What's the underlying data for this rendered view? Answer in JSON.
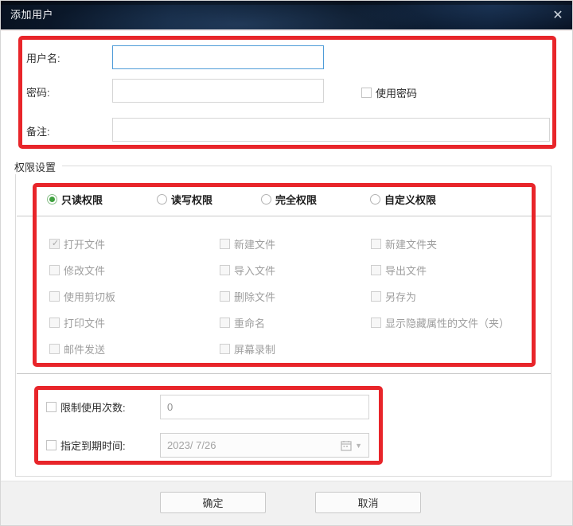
{
  "window": {
    "title": "添加用户",
    "close_glyph": "✕"
  },
  "form": {
    "username": {
      "label": "用户名:",
      "value": ""
    },
    "password": {
      "label": "密码:",
      "value": ""
    },
    "use_password": {
      "label": "使用密码",
      "checked": false
    },
    "note": {
      "label": "备注:",
      "value": ""
    }
  },
  "permissions": {
    "group_label": "权限设置",
    "levels": [
      {
        "label": "只读权限",
        "selected": true
      },
      {
        "label": "读写权限",
        "selected": false
      },
      {
        "label": "完全权限",
        "selected": false
      },
      {
        "label": "自定义权限",
        "selected": false
      }
    ],
    "items": [
      {
        "label": "打开文件",
        "checked": true,
        "disabled": true
      },
      {
        "label": "新建文件",
        "checked": false,
        "disabled": true
      },
      {
        "label": "新建文件夹",
        "checked": false,
        "disabled": true
      },
      {
        "label": "修改文件",
        "checked": false,
        "disabled": true
      },
      {
        "label": "导入文件",
        "checked": false,
        "disabled": true
      },
      {
        "label": "导出文件",
        "checked": false,
        "disabled": true
      },
      {
        "label": "使用剪切板",
        "checked": false,
        "disabled": true
      },
      {
        "label": "删除文件",
        "checked": false,
        "disabled": true
      },
      {
        "label": "另存为",
        "checked": false,
        "disabled": true
      },
      {
        "label": "打印文件",
        "checked": false,
        "disabled": true
      },
      {
        "label": "重命名",
        "checked": false,
        "disabled": true
      },
      {
        "label": "显示隐藏属性的文件（夹）",
        "checked": false,
        "disabled": true
      },
      {
        "label": "邮件发送",
        "checked": false,
        "disabled": true
      },
      {
        "label": "屏幕录制",
        "checked": false,
        "disabled": true
      }
    ]
  },
  "limits": {
    "usage_count": {
      "label": "限制使用次数:",
      "checked": false,
      "value": "0"
    },
    "expire_date": {
      "label": "指定到期时间:",
      "checked": false,
      "value": "2023/ 7/26"
    }
  },
  "footer": {
    "ok_label": "确定",
    "cancel_label": "取消"
  },
  "colors": {
    "annotation_red": "#e8252a",
    "focused_input_blue": "#4f9cd8",
    "radio_selected_green": "#3fa13f",
    "titlebar_navy": "#0d1e36",
    "disabled_text": "#9e9e9e"
  }
}
